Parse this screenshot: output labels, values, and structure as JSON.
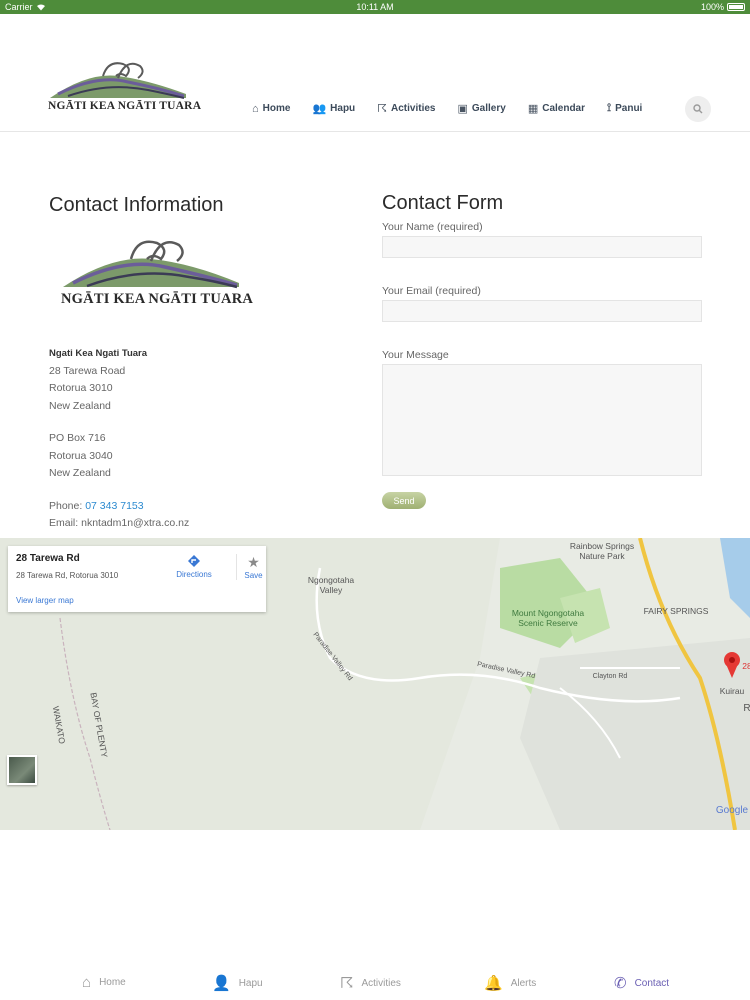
{
  "status": {
    "carrier": "Carrier",
    "time": "10:11 AM",
    "battery": "100%"
  },
  "header": {
    "logo_text": "NGĀTI KEA NGĀTI TUARA",
    "nav": [
      {
        "label": "Home",
        "icon": "home-icon"
      },
      {
        "label": "Hapu",
        "icon": "people-icon"
      },
      {
        "label": "Activities",
        "icon": "person-active-icon"
      },
      {
        "label": "Gallery",
        "icon": "gallery-icon"
      },
      {
        "label": "Calendar",
        "icon": "calendar-icon"
      },
      {
        "label": "Panui",
        "icon": "broadcast-icon"
      }
    ]
  },
  "contact_info": {
    "title": "Contact Information",
    "org": "Ngati Kea Ngati Tuara",
    "address1": [
      "28 Tarewa Road",
      "Rotorua 3010",
      "New Zealand"
    ],
    "address2": [
      "PO Box 716",
      "Rotorua 3040",
      "New Zealand"
    ],
    "phone_label": "Phone:",
    "phone": "07 343 7153",
    "email_label": "Email:",
    "email": "nkntadm1n@xtra.co.nz"
  },
  "contact_form": {
    "title": "Contact Form",
    "name_label": "Your Name (required)",
    "email_label": "Your Email (required)",
    "message_label": "Your Message",
    "send_label": "Send"
  },
  "map": {
    "card_title": "28 Tarewa Rd",
    "card_address": "28 Tarewa Rd, Rotorua 3010",
    "directions": "Directions",
    "save": "Save",
    "view_larger": "View larger map",
    "labels": {
      "valley": "Ngongotaha Valley",
      "rainbow": "Rainbow Springs Nature Park",
      "mount": "Mount Ngongotaha Scenic Reserve",
      "fairy": "FAIRY SPRINGS",
      "kuirau": "Kuirau",
      "bay": "BAY OF PLENTY",
      "waikato": "WAIKATO",
      "paradise1": "Paradise Valley Rd",
      "paradise2": "Paradise Valley Rd",
      "clayton": "Clayton Rd",
      "google": "Google",
      "pin_num": "28",
      "edge_r": "R"
    }
  },
  "tabs": [
    {
      "label": "Home",
      "icon": "home-icon"
    },
    {
      "label": "Hapu",
      "icon": "person-icon"
    },
    {
      "label": "Activities",
      "icon": "activity-icon"
    },
    {
      "label": "Alerts",
      "icon": "bell-icon"
    },
    {
      "label": "Contact",
      "icon": "phone-icon"
    }
  ]
}
